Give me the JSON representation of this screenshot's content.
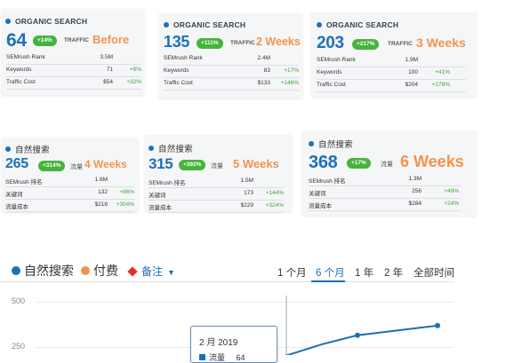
{
  "colors": {
    "brand_blue": "#1f6fb8",
    "growth_green": "#46b33c",
    "week_orange": "#f3944c",
    "note_red": "#d9362b"
  },
  "en_cards": [
    {
      "title": "ORGANIC SEARCH",
      "value": "64",
      "badge": "+14%",
      "traffic_label": "TRAFFIC",
      "period": "Before",
      "rows": [
        {
          "name": "SEMrush Rank",
          "value": "3.5M",
          "change": ""
        },
        {
          "name": "Keywords",
          "value": "71",
          "change": "+6%"
        },
        {
          "name": "Traffic Cost",
          "value": "$54",
          "change": "+32%"
        }
      ]
    },
    {
      "title": "ORGANIC SEARCH",
      "value": "135",
      "badge": "+111%",
      "traffic_label": "TRAFFIC",
      "period": "2 Weeks",
      "rows": [
        {
          "name": "SEMrush Rank",
          "value": "2.4M",
          "change": ""
        },
        {
          "name": "Keywords",
          "value": "83",
          "change": "+17%"
        },
        {
          "name": "Traffic Cost",
          "value": "$133",
          "change": "+146%"
        }
      ]
    },
    {
      "title": "ORGANIC SEARCH",
      "value": "203",
      "badge": "+217%",
      "traffic_label": "TRAFFIC",
      "period": "3 Weeks",
      "rows": [
        {
          "name": "SEMrush Rank",
          "value": "1.9M",
          "change": ""
        },
        {
          "name": "Keywords",
          "value": "100",
          "change": "+41%"
        },
        {
          "name": "Traffic Cost",
          "value": "$204",
          "change": "+278%"
        }
      ]
    }
  ],
  "cn_cards": [
    {
      "title": "自然搜索",
      "value": "265",
      "badge": "+314%",
      "traffic_label": "流量",
      "period": "4 Weeks",
      "rows": [
        {
          "name": "SEMrush 排名",
          "value": "1.6M",
          "change": ""
        },
        {
          "name": "关键词",
          "value": "132",
          "change": "+86%"
        },
        {
          "name": "流量成本",
          "value": "$218",
          "change": "+304%"
        }
      ]
    },
    {
      "title": "自然搜索",
      "value": "315",
      "badge": "+392%",
      "traffic_label": "流量",
      "period": "5 Weeks",
      "rows": [
        {
          "name": "SEMrush 排名",
          "value": "1.5M",
          "change": ""
        },
        {
          "name": "关键词",
          "value": "173",
          "change": "+144%"
        },
        {
          "name": "流量成本",
          "value": "$229",
          "change": "+324%"
        }
      ]
    },
    {
      "title": "自然搜索",
      "value": "368",
      "badge": "+17%",
      "traffic_label": "流量",
      "period": "6 Weeks",
      "rows": [
        {
          "name": "SEMrush 排名",
          "value": "1.3M",
          "change": ""
        },
        {
          "name": "关键词",
          "value": "256",
          "change": "+49%"
        },
        {
          "name": "流量成本",
          "value": "$284",
          "change": "+24%"
        }
      ]
    }
  ],
  "chart": {
    "legend": {
      "organic": "自然搜索",
      "paid": "付费",
      "notes": "备注"
    },
    "ranges": [
      "1 个月",
      "6 个月",
      "1 年",
      "2 年",
      "全部时间"
    ],
    "active_range": "6 个月",
    "y_ticks": [
      "500",
      "250"
    ],
    "tooltip": {
      "date": "2 月 2019",
      "series": "流量",
      "value": "64"
    }
  },
  "chart_data": {
    "type": "line",
    "ylim": [
      0,
      500
    ],
    "series": [
      {
        "name": "自然搜索",
        "values": [
          64,
          135,
          203,
          265,
          315,
          368
        ]
      }
    ]
  }
}
